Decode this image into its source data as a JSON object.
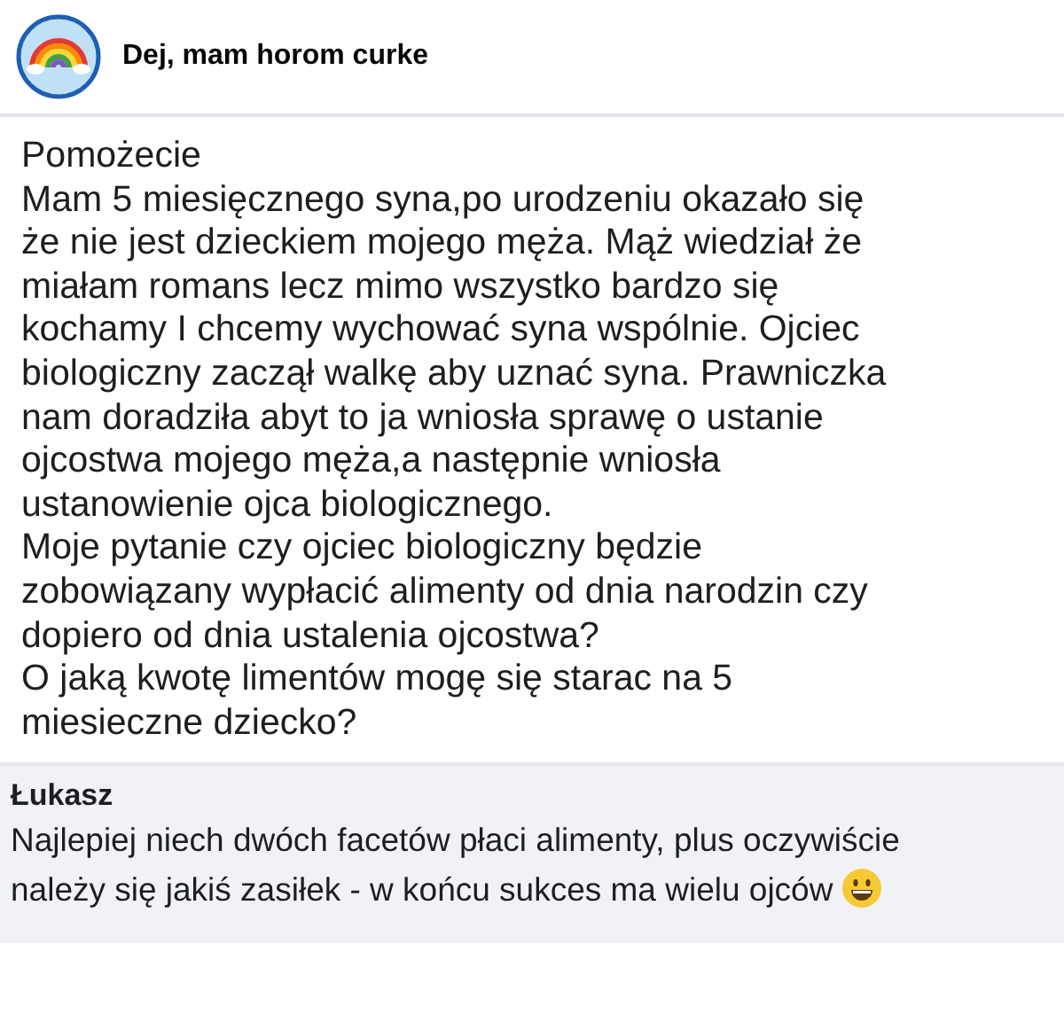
{
  "group": {
    "name": "Dej, mam horom curke"
  },
  "post": {
    "lines": [
      "Pomożecie",
      "Mam 5 miesięcznego syna,po urodzeniu okazało się",
      "że nie jest dzieckiem mojego męża. Mąż wiedział że",
      "miałam romans lecz mimo wszystko bardzo się",
      "kochamy I chcemy wychować syna wspólnie. Ojciec",
      "biologiczny zaczął walkę aby uznać syna. Prawniczka",
      "nam doradziła abyt to ja wniosła sprawę o ustanie",
      "ojcostwa mojego męża,a następnie wniosła",
      "ustanowienie ojca biologicznego.",
      "Moje pytanie czy ojciec biologiczny będzie",
      "zobowiązany wypłacić alimenty od dnia narodzin czy",
      "dopiero od dnia ustalenia ojcostwa?",
      "O jaką kwotę limentów mogę się starac na 5",
      "miesieczne dziecko?"
    ]
  },
  "comment": {
    "author": "Łukasz",
    "lines": [
      "Najlepiej niech dwóch facetów płaci alimenty, plus oczywiście",
      "należy się jakiś zasiłek - w końcu sukces ma wielu ojców"
    ]
  }
}
